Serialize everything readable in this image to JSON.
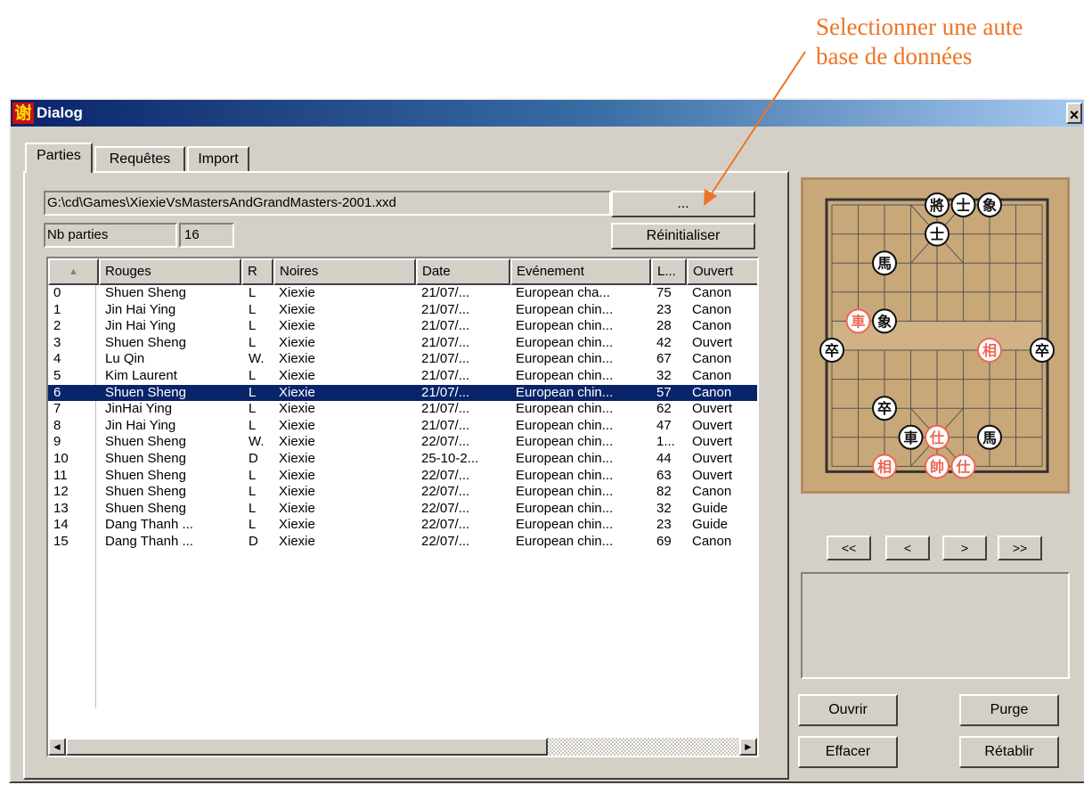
{
  "annotation": {
    "line1": "Selectionner une aute",
    "line2": "base de données",
    "color": "#ee7424"
  },
  "window": {
    "title": "Dialog",
    "icon_glyph": "谢",
    "close_glyph": "×"
  },
  "tabs": [
    {
      "label": "Parties",
      "active": true
    },
    {
      "label": "Requêtes",
      "active": false
    },
    {
      "label": "Import",
      "active": false
    }
  ],
  "db": {
    "path": "G:\\cd\\Games\\XiexieVsMastersAndGrandMasters-2001.xxd",
    "browse_label": "...",
    "nb_label": "Nb parties",
    "nb_value": "16",
    "reset_label": "Réinitialiser"
  },
  "table": {
    "sort_glyph": "▲",
    "columns": [
      "Rouges",
      "R",
      "Noires",
      "Date",
      "Evénement",
      "L...",
      "Ouvert"
    ],
    "selected_index": 6,
    "rows": [
      [
        "0",
        "Shuen Sheng",
        "L",
        "Xiexie",
        "21/07/...",
        "European cha...",
        "75",
        "Canon"
      ],
      [
        "1",
        "Jin Hai Ying",
        "L",
        "Xiexie",
        "21/07/...",
        "European chin...",
        "23",
        "Canon"
      ],
      [
        "2",
        "Jin Hai Ying",
        "L",
        "Xiexie",
        "21/07/...",
        "European chin...",
        "28",
        "Canon"
      ],
      [
        "3",
        "Shuen Sheng",
        "L",
        "Xiexie",
        "21/07/...",
        "European chin...",
        "42",
        "Ouvert"
      ],
      [
        "4",
        "Lu Qin",
        "W.",
        "Xiexie",
        "21/07/...",
        "European chin...",
        "67",
        "Canon"
      ],
      [
        "5",
        "Kim Laurent",
        "L",
        "Xiexie",
        "21/07/...",
        "European chin...",
        "32",
        "Canon"
      ],
      [
        "6",
        "Shuen Sheng",
        "L",
        "Xiexie",
        "21/07/...",
        "European chin...",
        "57",
        "Canon"
      ],
      [
        "7",
        "JinHai Ying",
        "L",
        "Xiexie",
        "21/07/...",
        "European chin...",
        "62",
        "Ouvert"
      ],
      [
        "8",
        "Jin Hai Ying",
        "L",
        "Xiexie",
        "21/07/...",
        "European chin...",
        "47",
        "Ouvert"
      ],
      [
        "9",
        "Shuen Sheng",
        "W.",
        "Xiexie",
        "22/07/...",
        "European chin...",
        "1...",
        "Ouvert"
      ],
      [
        "10",
        "Shuen Sheng",
        "D",
        "Xiexie",
        "25-10-2...",
        "European chin...",
        "44",
        "Ouvert"
      ],
      [
        "11",
        "Shuen Sheng",
        "L",
        "Xiexie",
        "22/07/...",
        "European chin...",
        "63",
        "Ouvert"
      ],
      [
        "12",
        "Shuen Sheng",
        "L",
        "Xiexie",
        "22/07/...",
        "European chin...",
        "82",
        "Canon"
      ],
      [
        "13",
        "Shuen Sheng",
        "L",
        "Xiexie",
        "22/07/...",
        "European chin...",
        "32",
        "Guide"
      ],
      [
        "14",
        "Dang Thanh ...",
        "L",
        "Xiexie",
        "22/07/...",
        "European chin...",
        "23",
        "Guide"
      ],
      [
        "15",
        "Dang Thanh ...",
        "D",
        "Xiexie",
        "22/07/...",
        "European chin...",
        "69",
        "Canon"
      ]
    ],
    "scroll_left": "◄",
    "scroll_right": "►"
  },
  "board": {
    "files": 9,
    "ranks": 10,
    "pieces": [
      {
        "glyph": "將",
        "side": "black",
        "file": 4,
        "rank": 0
      },
      {
        "glyph": "士",
        "side": "black",
        "file": 5,
        "rank": 0
      },
      {
        "glyph": "象",
        "side": "black",
        "file": 6,
        "rank": 0
      },
      {
        "glyph": "士",
        "side": "black",
        "file": 4,
        "rank": 1
      },
      {
        "glyph": "馬",
        "side": "black",
        "file": 2,
        "rank": 2
      },
      {
        "glyph": "車",
        "side": "red",
        "file": 1,
        "rank": 4
      },
      {
        "glyph": "象",
        "side": "black",
        "file": 2,
        "rank": 4
      },
      {
        "glyph": "卒",
        "side": "black",
        "file": 0,
        "rank": 5
      },
      {
        "glyph": "相",
        "side": "red",
        "file": 6,
        "rank": 5
      },
      {
        "glyph": "卒",
        "side": "black",
        "file": 8,
        "rank": 5
      },
      {
        "glyph": "卒",
        "side": "black",
        "file": 2,
        "rank": 7
      },
      {
        "glyph": "車",
        "side": "black",
        "file": 3,
        "rank": 8
      },
      {
        "glyph": "仕",
        "side": "red",
        "file": 4,
        "rank": 8
      },
      {
        "glyph": "馬",
        "side": "black",
        "file": 6,
        "rank": 8
      },
      {
        "glyph": "相",
        "side": "red",
        "file": 2,
        "rank": 9
      },
      {
        "glyph": "帥",
        "side": "red",
        "file": 4,
        "rank": 9
      },
      {
        "glyph": "仕",
        "side": "red",
        "file": 5,
        "rank": 9
      }
    ],
    "colors": {
      "wood": "#c8a878",
      "line": "#555555",
      "red": "#ee6655",
      "black": "#111111"
    }
  },
  "nav": {
    "first": "<<",
    "prev": "<",
    "next": ">",
    "last": ">>"
  },
  "actions": {
    "open": "Ouvrir",
    "purge": "Purge",
    "delete": "Effacer",
    "restore": "Rétablir"
  }
}
